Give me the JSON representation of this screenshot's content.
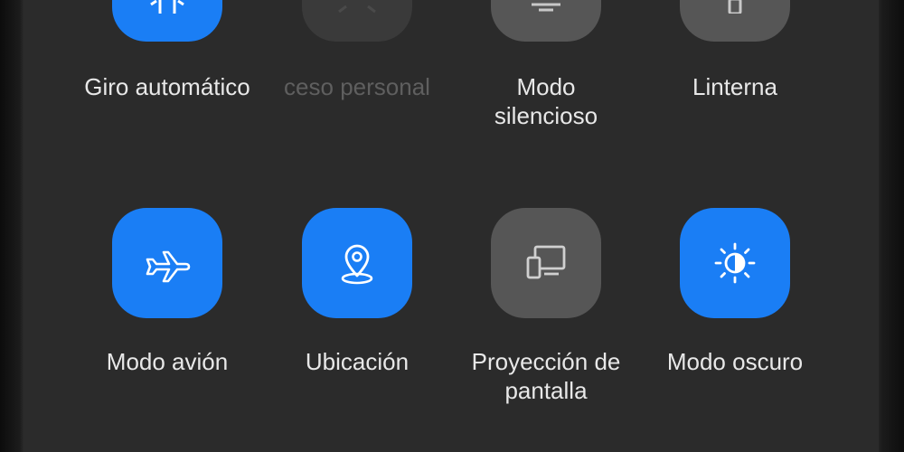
{
  "quick_settings": {
    "row1": [
      {
        "label": "Giro automático",
        "state": "on"
      },
      {
        "label": "ceso personal",
        "state": "dim"
      },
      {
        "label": "Modo\nsilencioso",
        "state": "off"
      },
      {
        "label": "Linterna",
        "state": "off"
      }
    ],
    "row2": [
      {
        "label": "Modo avión",
        "state": "on",
        "icon": "airplane-icon"
      },
      {
        "label": "Ubicación",
        "state": "on",
        "icon": "location-pin-icon"
      },
      {
        "label": "Proyección de\npantalla",
        "state": "off",
        "icon": "screen-cast-icon"
      },
      {
        "label": "Modo oscuro",
        "state": "on",
        "icon": "dark-mode-icon"
      }
    ]
  },
  "colors": {
    "active": "#1a7ef5",
    "inactive": "#565656",
    "panel": "#2b2b2b"
  }
}
